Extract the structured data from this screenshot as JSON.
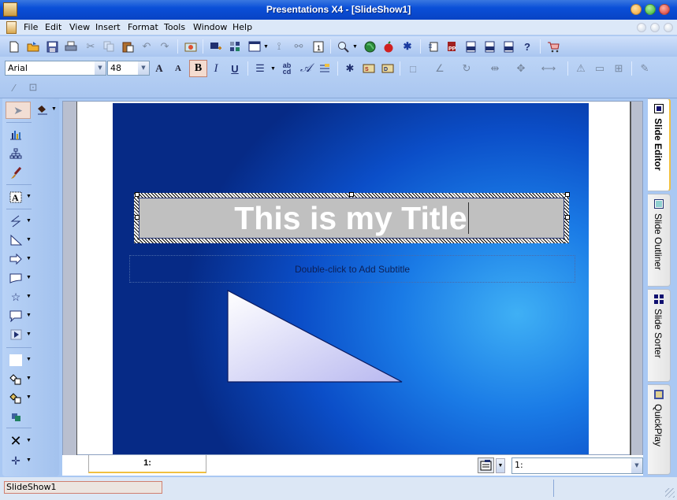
{
  "window": {
    "title": "Presentations X4 - [SlideShow1]",
    "controls": {
      "minimize": "minimize",
      "maximize": "maximize",
      "close": "close"
    },
    "control_colors": {
      "minimize": "#f0a030",
      "maximize": "#30b030",
      "close": "#d03030"
    }
  },
  "menubar": {
    "items": [
      "File",
      "Edit",
      "View",
      "Insert",
      "Format",
      "Tools",
      "Window",
      "Help"
    ]
  },
  "toolbar_standard": {
    "icons": [
      "new-icon",
      "open-icon",
      "save-icon",
      "print-icon",
      "cut-icon",
      "copy-icon",
      "paste-icon",
      "undo-icon",
      "redo-icon",
      "insert-picture-icon",
      "new-slide-icon",
      "slide-layout-icon",
      "slide-design-icon",
      "transition-icon",
      "link-icon",
      "slide-number-icon",
      "zoom-icon",
      "web-icon",
      "apple-icon",
      "snowflake-icon",
      "publish-icon",
      "publish-pp-icon",
      "publish-pdf-icon",
      "publish-xml-icon",
      "publish-html-icon",
      "help-icon",
      "shop-icon"
    ]
  },
  "toolbar_format": {
    "font_name": "Arial",
    "font_size": "48",
    "bold_active": true,
    "labels": {
      "bold": "B",
      "italic": "I",
      "underline": "U"
    }
  },
  "left_tools": [
    "select",
    "fill",
    "chart",
    "org-chart",
    "paint-brush",
    "text",
    "line",
    "triangle",
    "arrow",
    "callout-shape",
    "star",
    "speech-bubble",
    "action",
    "color-box",
    "shape-order",
    "shape-front",
    "rotate",
    "delete",
    "guide"
  ],
  "slide": {
    "title_text": "This is my Title",
    "subtitle_placeholder": "Double-click to Add Subtitle"
  },
  "right_tabs": [
    {
      "label": "Slide Editor",
      "active": true
    },
    {
      "label": "Slide Outliner",
      "active": false
    },
    {
      "label": "Slide Sorter",
      "active": false
    },
    {
      "label": "QuickPlay",
      "active": false
    }
  ],
  "bottom": {
    "slide_tab_label": "1:",
    "slide_select_value": "1:"
  },
  "status": {
    "document_name": "SlideShow1"
  }
}
